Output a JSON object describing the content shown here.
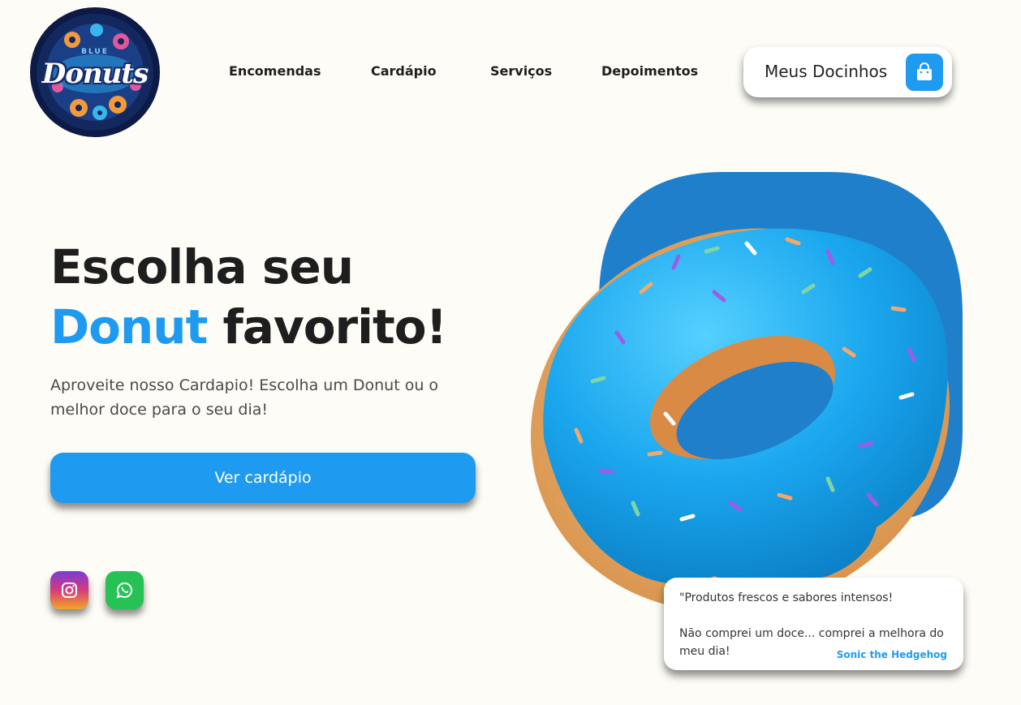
{
  "brand": {
    "logo_small": "BLUE",
    "logo_word": "Donuts"
  },
  "nav": {
    "items": [
      "Encomendas",
      "Cardápio",
      "Serviços",
      "Depoimentos"
    ]
  },
  "cart": {
    "label": "Meus Docinhos",
    "icon": "shopping-bag-icon"
  },
  "hero": {
    "title_line1": "Escolha seu",
    "title_accent": "Donut",
    "title_rest": "favorito!",
    "subtitle": "Aproveite nosso Cardapio! Escolha um Donut ou o melhor doce para o seu dia!",
    "cta_label": "Ver cardápio"
  },
  "social": {
    "instagram_icon": "instagram-icon",
    "whatsapp_icon": "whatsapp-icon"
  },
  "testimonial": {
    "quote_line1": "\"Produtos frescos e sabores intensos!",
    "quote_line2": "Não comprei um doce... comprei a melhora do meu dia!",
    "author": "Sonic the Hedgehog"
  },
  "colors": {
    "accent": "#1e9bf0",
    "background": "#fdfcf6",
    "blob": "#1f7fca",
    "whatsapp": "#27c256"
  }
}
